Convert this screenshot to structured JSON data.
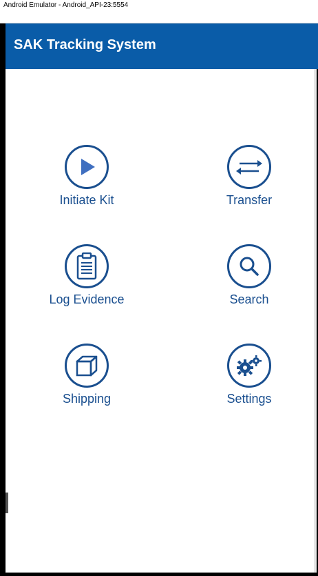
{
  "window": {
    "title": "Android Emulator - Android_API-23:5554"
  },
  "app": {
    "title": "SAK Tracking System",
    "accent_color": "#0a5ca8",
    "icon_color": "#1a4f8f"
  },
  "menu": {
    "items": [
      {
        "label": "Initiate Kit",
        "icon": "play-icon"
      },
      {
        "label": "Transfer",
        "icon": "transfer-arrows-icon"
      },
      {
        "label": "Log Evidence",
        "icon": "clipboard-icon"
      },
      {
        "label": "Search",
        "icon": "search-icon"
      },
      {
        "label": "Shipping",
        "icon": "box-icon"
      },
      {
        "label": "Settings",
        "icon": "gears-icon"
      }
    ]
  }
}
